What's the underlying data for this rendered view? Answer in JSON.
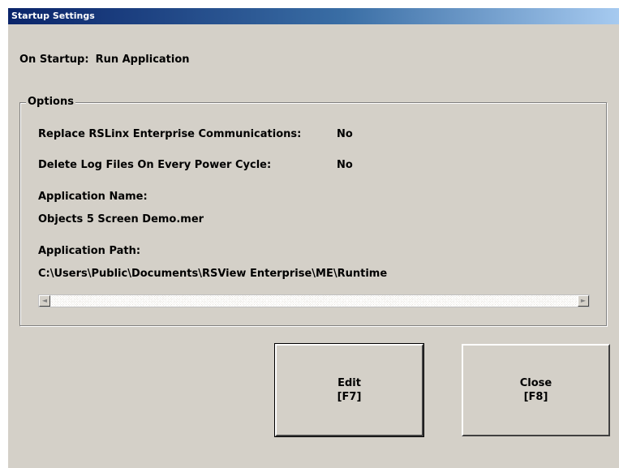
{
  "window": {
    "title": "Startup Settings"
  },
  "startup": {
    "label": "On Startup:",
    "value": "Run Application"
  },
  "options": {
    "legend": "Options",
    "replace_comms_label": "Replace RSLinx Enterprise Communications:",
    "replace_comms_value": "No",
    "delete_logs_label": "Delete Log Files On Every Power Cycle:",
    "delete_logs_value": "No",
    "app_name_label": "Application Name:",
    "app_name_value": "Objects 5 Screen Demo.mer",
    "app_path_label": "Application Path:",
    "app_path_value": "C:\\Users\\Public\\Documents\\RSView Enterprise\\ME\\Runtime",
    "scroll_left_glyph": "◄",
    "scroll_right_glyph": "►"
  },
  "buttons": {
    "edit_label": "Edit",
    "edit_key": "[F7]",
    "close_label": "Close",
    "close_key": "[F8]"
  },
  "colors": {
    "dialog_bg": "#d4d0c8",
    "titlebar_start": "#0a246a",
    "titlebar_end": "#a6caf0"
  }
}
